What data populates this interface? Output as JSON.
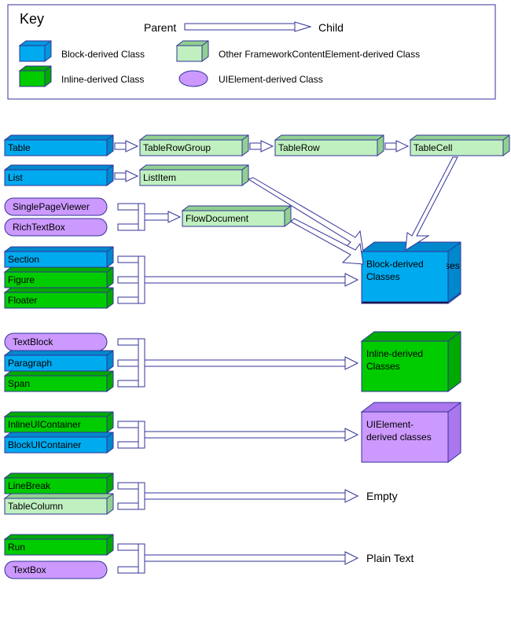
{
  "key": {
    "title": "Key",
    "parent_label": "Parent",
    "child_label": "Child",
    "swatches": {
      "block": "Block-derived Class",
      "inline": "Inline-derived Class",
      "other": "Other FrameworkContentElement-derived Class",
      "uielement": "UIElement-derived Class"
    }
  },
  "colors": {
    "block": "#00AAEE",
    "inline": "#00CC00",
    "other": "#C0F0C0",
    "uielement": "#CC99FF",
    "stroke": "#333399"
  },
  "rows": {
    "table": "Table",
    "tableRowGroup": "TableRowGroup",
    "tableRow": "TableRow",
    "tableCell": "TableCell",
    "list": "List",
    "listItem": "ListItem",
    "singlePageViewer": "SinglePageViewer",
    "richTextBox": "RichTextBox",
    "flowDocument": "FlowDocument",
    "section": "Section",
    "figure": "Figure",
    "floater": "Floater",
    "textBlock": "TextBlock",
    "paragraph": "Paragraph",
    "span": "Span",
    "inlineUIContainer": "InlineUIContainer",
    "blockUIContainer": "BlockUIContainer",
    "lineBreak": "LineBreak",
    "tableColumn": "TableColumn",
    "run": "Run",
    "textBox": "TextBox"
  },
  "targets": {
    "block": "Block-derived Classes",
    "inline": "Inline-derived Classes",
    "uielement": "UIElement-derived classes",
    "empty": "Empty",
    "plainText": "Plain Text"
  },
  "chart_data": {
    "type": "diagram",
    "title": "WPF TextFlow content schema",
    "legend": {
      "Block-derived Class": "#00AAEE",
      "Inline-derived Class": "#00CC00",
      "Other FrameworkContentElement-derived Class": "#C0F0C0",
      "UIElement-derived Class": "#CC99FF"
    },
    "nodes": [
      {
        "id": "Table",
        "type": "Block-derived"
      },
      {
        "id": "TableRowGroup",
        "type": "Other"
      },
      {
        "id": "TableRow",
        "type": "Other"
      },
      {
        "id": "TableCell",
        "type": "Other"
      },
      {
        "id": "List",
        "type": "Block-derived"
      },
      {
        "id": "ListItem",
        "type": "Other"
      },
      {
        "id": "SinglePageViewer",
        "type": "UIElement-derived"
      },
      {
        "id": "RichTextBox",
        "type": "UIElement-derived"
      },
      {
        "id": "FlowDocument",
        "type": "Other"
      },
      {
        "id": "Section",
        "type": "Block-derived"
      },
      {
        "id": "Figure",
        "type": "Inline-derived"
      },
      {
        "id": "Floater",
        "type": "Inline-derived"
      },
      {
        "id": "TextBlock",
        "type": "UIElement-derived"
      },
      {
        "id": "Paragraph",
        "type": "Block-derived"
      },
      {
        "id": "Span",
        "type": "Inline-derived"
      },
      {
        "id": "InlineUIContainer",
        "type": "Inline-derived"
      },
      {
        "id": "BlockUIContainer",
        "type": "Block-derived"
      },
      {
        "id": "LineBreak",
        "type": "Inline-derived"
      },
      {
        "id": "TableColumn",
        "type": "Other"
      },
      {
        "id": "Run",
        "type": "Inline-derived"
      },
      {
        "id": "TextBox",
        "type": "UIElement-derived"
      },
      {
        "id": "Block-derived Classes",
        "type": "target-block"
      },
      {
        "id": "Inline-derived Classes",
        "type": "target-inline"
      },
      {
        "id": "UIElement-derived classes",
        "type": "target-uielement"
      },
      {
        "id": "Empty",
        "type": "target-text"
      },
      {
        "id": "Plain Text",
        "type": "target-text"
      }
    ],
    "edges": [
      {
        "parent": "Table",
        "child": "TableRowGroup"
      },
      {
        "parent": "TableRowGroup",
        "child": "TableRow"
      },
      {
        "parent": "TableRow",
        "child": "TableCell"
      },
      {
        "parent": "TableCell",
        "child": "Block-derived Classes"
      },
      {
        "parent": "List",
        "child": "ListItem"
      },
      {
        "parent": "ListItem",
        "child": "Block-derived Classes"
      },
      {
        "parent": "SinglePageViewer",
        "child": "FlowDocument"
      },
      {
        "parent": "RichTextBox",
        "child": "FlowDocument"
      },
      {
        "parent": "FlowDocument",
        "child": "Block-derived Classes"
      },
      {
        "parent": "Section",
        "child": "Block-derived Classes"
      },
      {
        "parent": "Figure",
        "child": "Block-derived Classes"
      },
      {
        "parent": "Floater",
        "child": "Block-derived Classes"
      },
      {
        "parent": "TextBlock",
        "child": "Inline-derived Classes"
      },
      {
        "parent": "Paragraph",
        "child": "Inline-derived Classes"
      },
      {
        "parent": "Span",
        "child": "Inline-derived Classes"
      },
      {
        "parent": "InlineUIContainer",
        "child": "UIElement-derived classes"
      },
      {
        "parent": "BlockUIContainer",
        "child": "UIElement-derived classes"
      },
      {
        "parent": "LineBreak",
        "child": "Empty"
      },
      {
        "parent": "TableColumn",
        "child": "Empty"
      },
      {
        "parent": "Run",
        "child": "Plain Text"
      },
      {
        "parent": "TextBox",
        "child": "Plain Text"
      }
    ]
  }
}
